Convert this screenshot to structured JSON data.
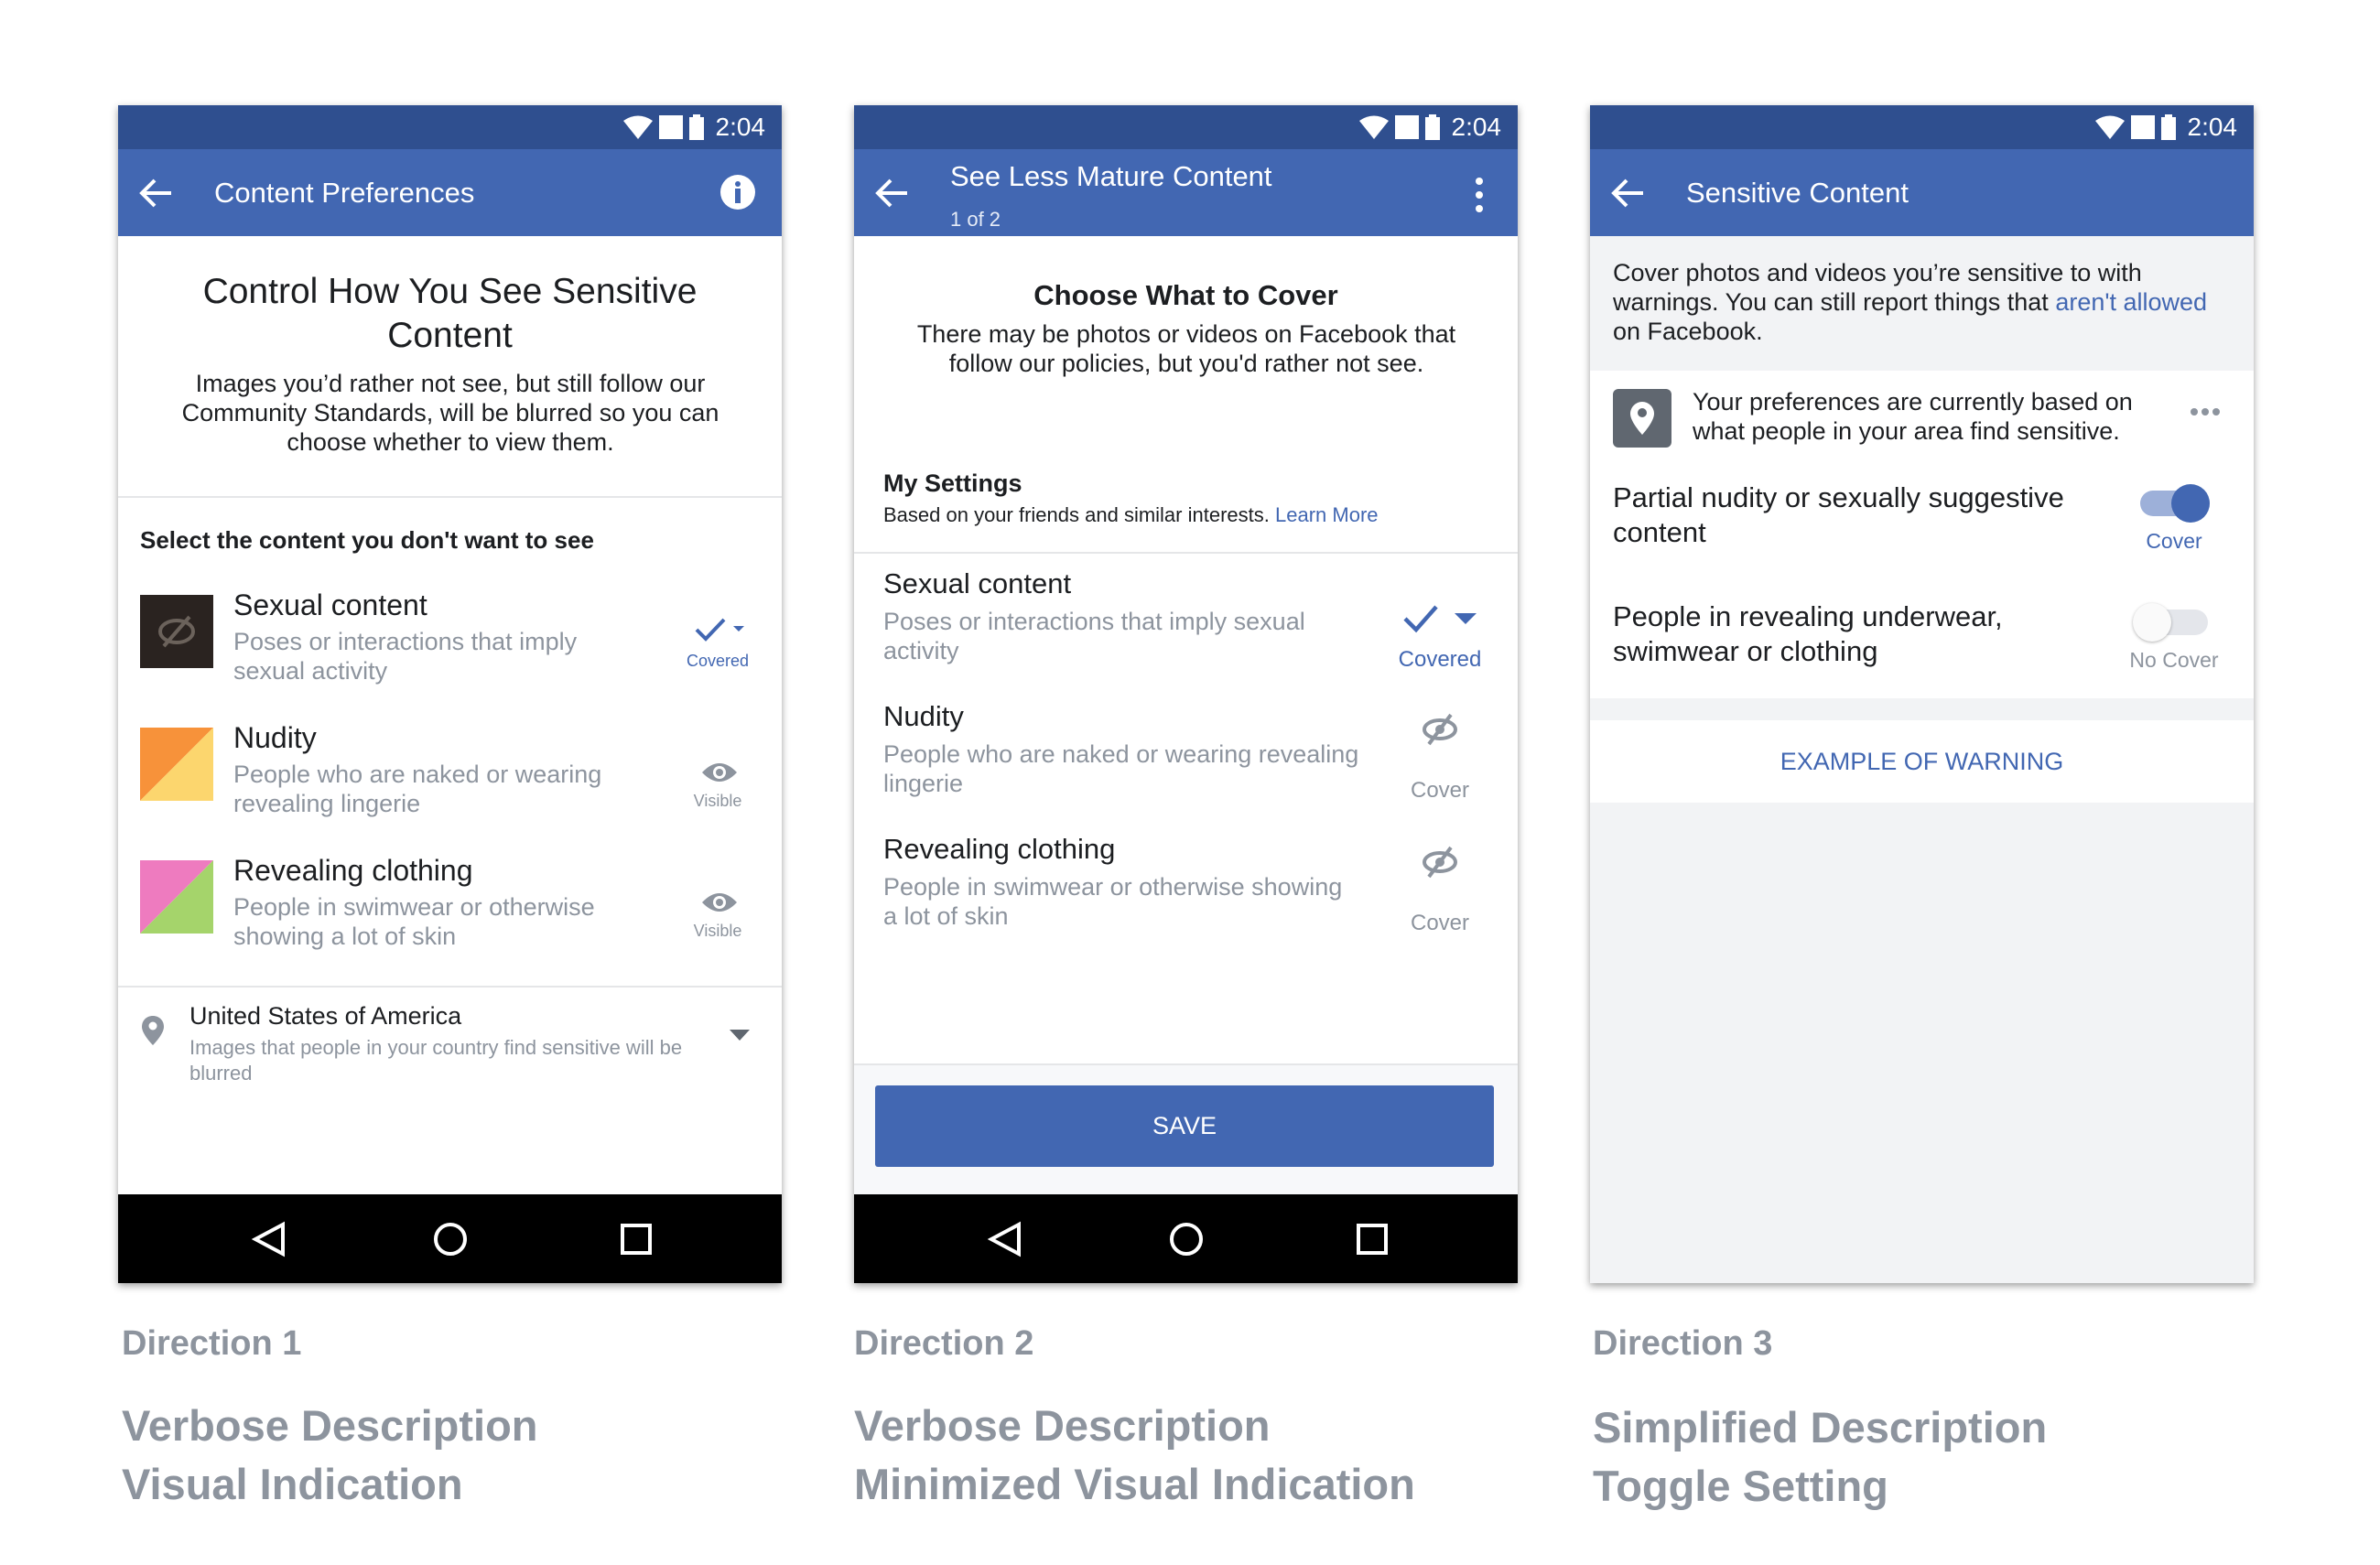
{
  "status_bar": {
    "time": "2:04"
  },
  "direction1": {
    "appbar_title": "Content Preferences",
    "heading": "Control How You See Sensitive Content",
    "description": "Images you’d rather not see, but still follow our Community Standards, will be blurred so you can choose whether to view them.",
    "section_label": "Select the content you don't want to see",
    "items": [
      {
        "title": "Sexual content",
        "desc": "Poses or interactions that imply sexual activity",
        "status": "Covered",
        "icon": "covered-check-icon"
      },
      {
        "title": "Nudity",
        "desc": "People who are naked or wearing revealing lingerie",
        "status": "Visible",
        "icon": "eye-icon"
      },
      {
        "title": "Revealing clothing",
        "desc": "People in swimwear or otherwise showing a lot of skin",
        "status": "Visible",
        "icon": "eye-icon"
      }
    ],
    "location": {
      "title": "United States of America",
      "desc": "Images that people in your country find sensitive will be blurred"
    },
    "colors": {
      "covered": "#4267b2",
      "nudity_a": "#f7923a",
      "nudity_b": "#fcd66e",
      "clothing_a": "#ee7bbf",
      "clothing_b": "#a5d46b"
    }
  },
  "direction2": {
    "appbar_title": "See Less Mature Content",
    "appbar_sub": "1 of 2",
    "heading": "Choose What to Cover",
    "description": "There may be photos or videos on Facebook that follow our policies, but you'd rather not see.",
    "settings_label": "My Settings",
    "settings_desc": "Based on your friends and similar interests.",
    "learn_more": "Learn More",
    "items": [
      {
        "title": "Sexual content",
        "desc": "Poses or interactions that imply sexual activity",
        "status": "Covered",
        "icon": "check-dropdown-icon"
      },
      {
        "title": "Nudity",
        "desc": "People who are naked or wearing revealing lingerie",
        "status": "Cover",
        "icon": "eye-slash-icon"
      },
      {
        "title": "Revealing clothing",
        "desc": "People in swimwear or otherwise showing a lot of skin",
        "status": "Cover",
        "icon": "eye-slash-icon"
      }
    ],
    "save_label": "SAVE"
  },
  "direction3": {
    "appbar_title": "Sensitive Content",
    "intro_text": "Cover photos and videos you’re sensitive to with warnings. You can still report things that",
    "intro_link": "aren't allowed",
    "intro_tail": "on Facebook.",
    "pref_text": "Your preferences are currently based on what people in your area find sensitive.",
    "toggles": [
      {
        "label": "Partial nudity or sexually suggestive content",
        "state": "Cover",
        "on": true
      },
      {
        "label": "People in revealing underwear, swimwear or clothing",
        "state": "No Cover",
        "on": false
      }
    ],
    "example_label": "EXAMPLE OF WARNING"
  },
  "captions": [
    {
      "direction": "Direction 1",
      "line1": "Verbose Description",
      "line2": "Visual Indication"
    },
    {
      "direction": "Direction 2",
      "line1": "Verbose Description",
      "line2": "Minimized Visual Indication"
    },
    {
      "direction": "Direction 3",
      "line1": "Simplified Description",
      "line2": "Toggle Setting"
    }
  ],
  "colors": {
    "status_bar": "#2f4f8f",
    "app_bar": "#4267b2",
    "link": "#4267b2",
    "muted_text": "#8d949e",
    "nav_bar": "#000000",
    "panel_gray": "#f2f3f5"
  }
}
